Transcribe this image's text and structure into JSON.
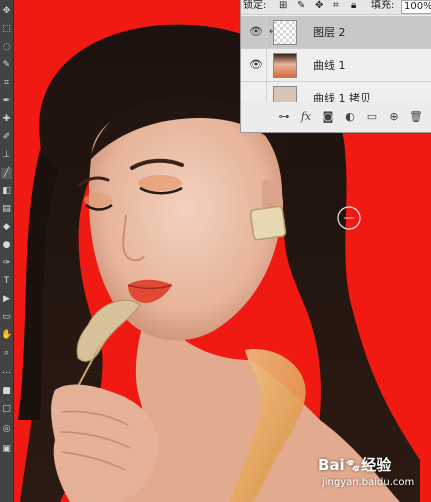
{
  "layers_panel": {
    "lock_label": "锁定:",
    "fill_label": "填充:",
    "fill_value": "100%",
    "layers": [
      {
        "name": "图层 2",
        "selected": true,
        "visible": true
      },
      {
        "name": "曲线 1",
        "selected": false,
        "visible": true
      },
      {
        "name": "曲线 1 拷贝",
        "selected": false,
        "visible": false
      }
    ]
  },
  "canvas": {
    "background_color": "#f01a12",
    "brush_cursor": "circle-brush-cursor"
  },
  "watermark": {
    "brand": "Bai",
    "brand_suffix": "经验",
    "url": "jingyan.baidu.com"
  },
  "colors": {
    "panel_bg": "#efefef",
    "selected_row": "#c8c8c8",
    "toolbar_bg": "#434343"
  }
}
